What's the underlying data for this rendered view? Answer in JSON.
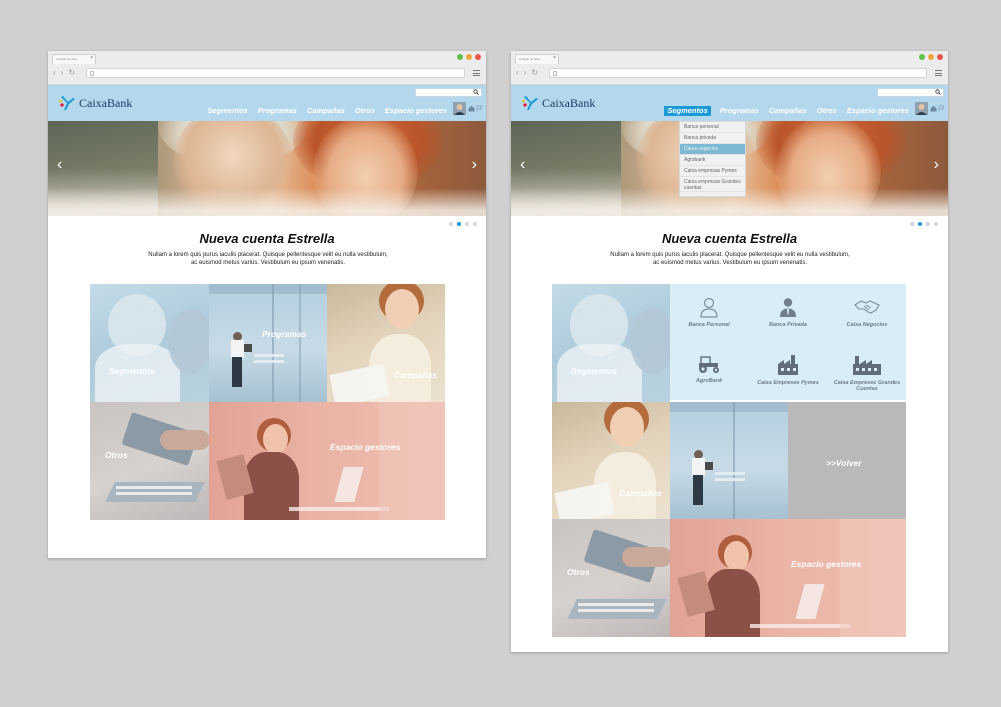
{
  "browser": {
    "tab_title": "Colegio de docs",
    "tab_close": "×",
    "nav_back": "‹",
    "nav_forward": "›",
    "nav_reload": "↻"
  },
  "brand": {
    "name": "CaixaBank",
    "color_navy": "#123a5e",
    "color_blue": "#1b9ad6",
    "color_red": "#e8112d",
    "header_bg": "#b3d7ec"
  },
  "nav": {
    "items": [
      "Segmentos",
      "Programas",
      "Campañas",
      "Otros",
      "Espacio gestores"
    ]
  },
  "hero": {
    "prev": "‹",
    "next": "›",
    "active_slide": 2,
    "slide_count": 4
  },
  "content": {
    "title": "Nueva cuenta Estrella",
    "description_line1": "Nullam a lorem quis purus iaculis placerat. Quisque pellentesque velit eu nulla vestibulum,",
    "description_line2": "ac euismod metus varius. Vestibulum eu ipsum venenatis."
  },
  "tiles": {
    "segmentos": "Segmentos",
    "programas": "Programas",
    "campanas": "Campañas",
    "otros": "Otros",
    "espacio": "Espacio gestores",
    "volver": ">>Volver"
  },
  "dropdown": {
    "items": [
      "Banca personal",
      "Banca privada",
      "Caixa negocios",
      "Agrobank",
      "Caixa empresas Pymes",
      "Caixa empresas Grandes cuentas"
    ],
    "highlighted": 2
  },
  "segments_panel": {
    "items": [
      {
        "label": "Banca Personal",
        "icon": "person-outline-icon"
      },
      {
        "label": "Banca Privada",
        "icon": "businessman-icon"
      },
      {
        "label": "Caixa Negocios",
        "icon": "handshake-icon"
      },
      {
        "label": "AgroBank",
        "icon": "tractor-icon"
      },
      {
        "label": "Caixa Empreses Pymes",
        "icon": "factory-small-icon"
      },
      {
        "label": "Caixa Empreses Grandes Cuentas",
        "icon": "factory-large-icon"
      }
    ]
  }
}
